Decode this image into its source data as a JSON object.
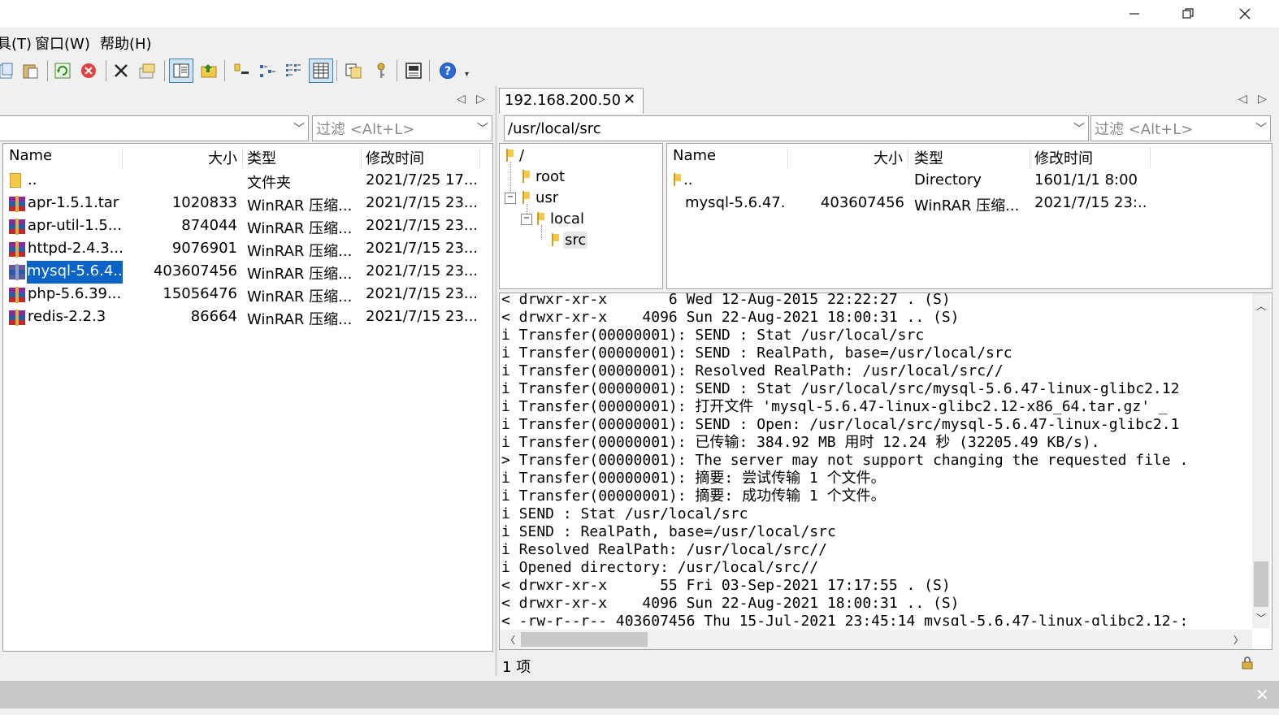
{
  "menu": [
    "具(T)",
    "窗口(W)",
    "帮助(H)"
  ],
  "local": {
    "path": "",
    "filter_placeholder": "过滤 <Alt+L>",
    "columns": {
      "name": "Name",
      "size": "大小",
      "type": "类型",
      "modified": "修改时间"
    },
    "files": [
      {
        "name": "..",
        "size": "",
        "type": "文件夹",
        "modified": "2021/7/25 17...",
        "icon": "folder-icon"
      },
      {
        "name": "apr-1.5.1.tar",
        "size": "1020833",
        "type": "WinRAR 压缩...",
        "modified": "2021/7/15 23...",
        "icon": "winrar-icon"
      },
      {
        "name": "apr-util-1.5....",
        "size": "874044",
        "type": "WinRAR 压缩...",
        "modified": "2021/7/15 23...",
        "icon": "winrar-icon"
      },
      {
        "name": "httpd-2.4.3...",
        "size": "9076901",
        "type": "WinRAR 压缩...",
        "modified": "2021/7/15 23...",
        "icon": "winrar-icon"
      },
      {
        "name": "mysql-5.6.4...",
        "size": "403607456",
        "type": "WinRAR 压缩...",
        "modified": "2021/7/15 23...",
        "icon": "winrar-icon",
        "selected": true
      },
      {
        "name": "php-5.6.39....",
        "size": "15056476",
        "type": "WinRAR 压缩...",
        "modified": "2021/7/15 23...",
        "icon": "winrar-icon"
      },
      {
        "name": "redis-2.2.3",
        "size": "86664",
        "type": "WinRAR 压缩...",
        "modified": "2021/7/15 23...",
        "icon": "winrar-icon"
      }
    ]
  },
  "remote": {
    "tab_label": "192.168.200.50",
    "path": "/usr/local/src",
    "filter_placeholder": "过滤 <Alt+L>",
    "tree": [
      {
        "label": "/",
        "depth": 0
      },
      {
        "label": "root",
        "depth": 1
      },
      {
        "label": "usr",
        "depth": 1
      },
      {
        "label": "local",
        "depth": 2
      },
      {
        "label": "src",
        "depth": 3
      }
    ],
    "columns": {
      "name": "Name",
      "size": "大小",
      "type": "类型",
      "modified": "修改时间"
    },
    "files": [
      {
        "name": "..",
        "size": "",
        "type": "Directory",
        "modified": "1601/1/1 8:00"
      },
      {
        "name": "mysql-5.6.47...",
        "size": "403607456",
        "type": "WinRAR 压缩...",
        "modified": "2021/7/15 23:..."
      }
    ],
    "status": "1 项"
  },
  "log_lines": [
    "< drwxr-xr-x       6 Wed 12-Aug-2015 22:22:27 . (S)",
    "< drwxr-xr-x    4096 Sun 22-Aug-2021 18:00:31 .. (S)",
    "i Transfer(00000001): SEND : Stat /usr/local/src",
    "i Transfer(00000001): SEND : RealPath, base=/usr/local/src",
    "i Transfer(00000001): Resolved RealPath: /usr/local/src//",
    "i Transfer(00000001): SEND : Stat /usr/local/src/mysql-5.6.47-linux-glibc2.12",
    "i Transfer(00000001): 打开文件 'mysql-5.6.47-linux-glibc2.12-x86_64.tar.gz' _",
    "i Transfer(00000001): SEND : Open: /usr/local/src/mysql-5.6.47-linux-glibc2.1",
    "i Transfer(00000001): 已传输: 384.92 MB 用时 12.24 秒 (32205.49 KB/s).",
    "> Transfer(00000001): The server may not support changing the requested file .",
    "i Transfer(00000001): 摘要: 尝试传输 1 个文件。",
    "i Transfer(00000001): 摘要: 成功传输 1 个文件。",
    "i SEND : Stat /usr/local/src",
    "i SEND : RealPath, base=/usr/local/src",
    "i Resolved RealPath: /usr/local/src//",
    "i Opened directory: /usr/local/src//",
    "< drwxr-xr-x      55 Fri 03-Sep-2021 17:17:55 . (S)",
    "< drwxr-xr-x    4096 Sun 22-Aug-2021 18:00:31 .. (S)",
    "< -rw-r--r-- 403607456 Thu 15-Jul-2021 23:45:14 mysql-5.6.47-linux-glibc2.12-:"
  ],
  "colors": {
    "selection": "#0a64c8",
    "background": "#f0f0f0"
  }
}
